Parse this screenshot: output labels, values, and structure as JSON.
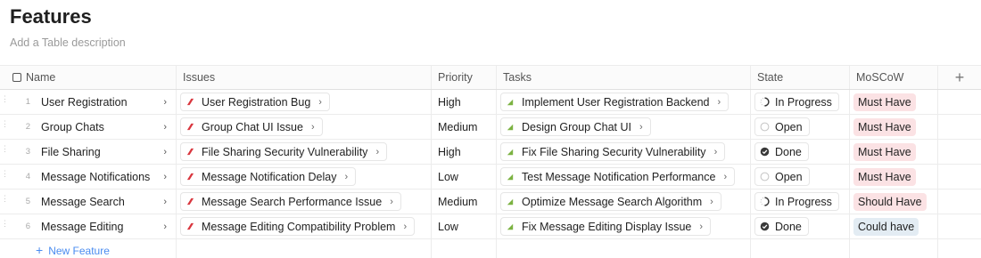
{
  "page": {
    "title": "Features",
    "description_placeholder": "Add a Table description"
  },
  "columns": {
    "name": "Name",
    "issues": "Issues",
    "priority": "Priority",
    "tasks": "Tasks",
    "state": "State",
    "moscow": "MoSCoW"
  },
  "rows": [
    {
      "num": "1",
      "name": "User Registration",
      "issue": "User Registration Bug",
      "priority": "High",
      "task": "Implement User Registration Backend",
      "state": "In Progress",
      "state_kind": "in-progress",
      "moscow": "Must Have",
      "moscow_kind": "must"
    },
    {
      "num": "2",
      "name": "Group Chats",
      "issue": "Group Chat UI Issue",
      "priority": "Medium",
      "task": "Design Group Chat UI",
      "state": "Open",
      "state_kind": "open",
      "moscow": "Must Have",
      "moscow_kind": "must"
    },
    {
      "num": "3",
      "name": "File Sharing",
      "issue": "File Sharing Security Vulnerability",
      "priority": "High",
      "task": "Fix File Sharing Security Vulnerability",
      "state": "Done",
      "state_kind": "done",
      "moscow": "Must Have",
      "moscow_kind": "must"
    },
    {
      "num": "4",
      "name": "Message Notifications",
      "issue": "Message Notification Delay",
      "priority": "Low",
      "task": "Test Message Notification Performance",
      "state": "Open",
      "state_kind": "open",
      "moscow": "Must Have",
      "moscow_kind": "must"
    },
    {
      "num": "5",
      "name": "Message Search",
      "issue": "Message Search Performance Issue",
      "priority": "Medium",
      "task": "Optimize Message Search Algorithm",
      "state": "In Progress",
      "state_kind": "in-progress",
      "moscow": "Should Have",
      "moscow_kind": "should"
    },
    {
      "num": "6",
      "name": "Message Editing",
      "issue": "Message Editing Compatibility Problem",
      "priority": "Low",
      "task": "Fix Message Editing Display Issue",
      "state": "Done",
      "state_kind": "done",
      "moscow": "Could have",
      "moscow_kind": "could"
    }
  ],
  "new_feature_label": "New Feature",
  "icons": {
    "header_checkbox": "checkbox-icon",
    "add_column": "plus-icon",
    "issue": "issue-icon",
    "task": "task-icon",
    "chevron": "chevron-right-icon"
  },
  "colors": {
    "issue_icon": "#d9363e",
    "task_icon": "#7bb241",
    "must_bg": "#fbe2e4",
    "should_bg": "#fbe2e4",
    "could_bg": "#e3ecf3",
    "link": "#4a8cf0"
  }
}
